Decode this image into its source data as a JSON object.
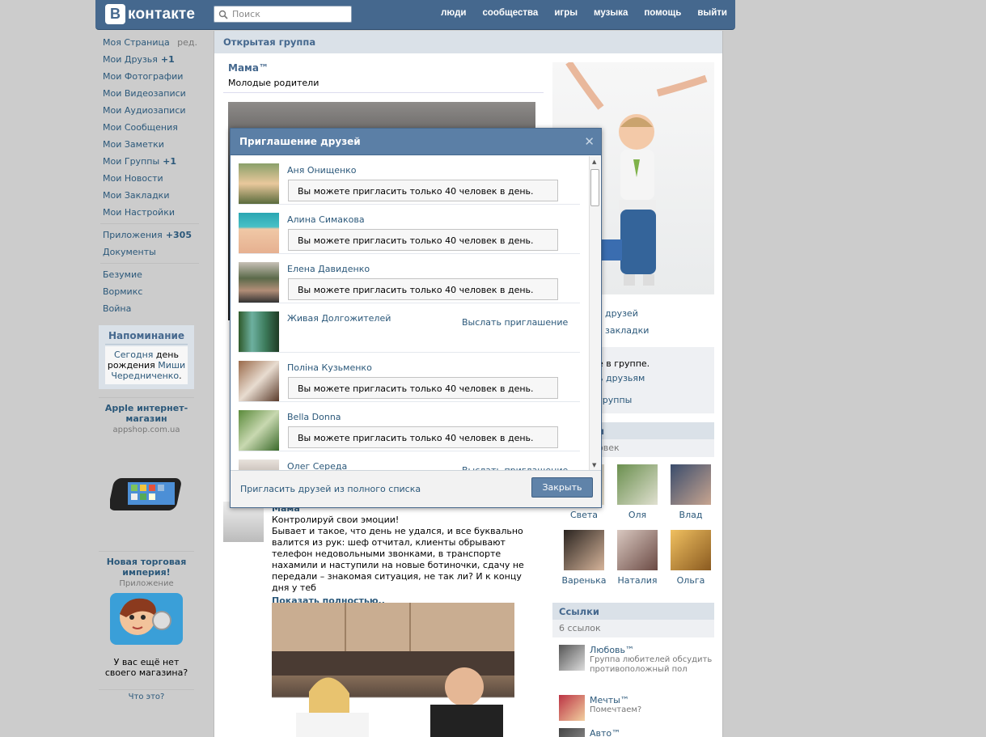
{
  "header": {
    "logo_letter": "В",
    "logo_text": "контакте",
    "search_placeholder": "Поиск",
    "nav": [
      "люди",
      "сообщества",
      "игры",
      "музыка",
      "помощь",
      "выйти"
    ]
  },
  "left_menu": {
    "items": [
      {
        "label": "Моя Страница",
        "extra": "ред."
      },
      {
        "label": "Мои Друзья",
        "count": "+1"
      },
      {
        "label": "Мои Фотографии"
      },
      {
        "label": "Мои Видеозаписи"
      },
      {
        "label": "Мои Аудиозаписи"
      },
      {
        "label": "Мои Сообщения"
      },
      {
        "label": "Мои Заметки"
      },
      {
        "label": "Мои Группы",
        "count": "+1"
      },
      {
        "label": "Мои Новости"
      },
      {
        "label": "Мои Закладки"
      },
      {
        "label": "Мои Настройки"
      }
    ],
    "apps": [
      {
        "label": "Приложения",
        "count": "+305"
      },
      {
        "label": "Документы"
      }
    ],
    "shortcuts": [
      "Безумие",
      "Вормикс",
      "Война"
    ]
  },
  "reminder": {
    "title": "Напоминание",
    "today": "Сегодня",
    "text1": "день",
    "text2": "рождения",
    "name_first": "Миши",
    "name_last": "Чередниченко",
    "dot": "."
  },
  "ads": [
    {
      "title": "Apple интернет-магазин",
      "sub": "appshop.com.ua"
    },
    {
      "title": "Новая торговая империя!",
      "sub": "Приложение",
      "caption": "У вас ещё нет своего магазина?"
    }
  ],
  "ads_footer": "Что это?",
  "content": {
    "header": "Открытая группа",
    "group_name": "Мама™",
    "group_status": "Молодые родители",
    "side_partial": [
      "ь друзей",
      "в закладки",
      "е в группе.",
      "ь друзьям",
      "группы"
    ],
    "members_head_partial": "и",
    "members_sub_partial": "овек"
  },
  "friends": [
    {
      "name": "Света"
    },
    {
      "name": "Оля"
    },
    {
      "name": "Влад"
    },
    {
      "name": "Варенька"
    },
    {
      "name": "Наталия"
    },
    {
      "name": "Ольга"
    }
  ],
  "links": {
    "title": "Ссылки",
    "count": "6 ссылок",
    "items": [
      {
        "title": "Любовь™",
        "desc": "Группа любителей обсудить противоположный пол"
      },
      {
        "title": "Мечты™",
        "desc": "Помечтаем?"
      },
      {
        "title": "Авто™",
        "desc": ""
      }
    ]
  },
  "post": {
    "author": "Мама™",
    "text": "Контролируй свои эмоции!\nБывает и такое, что день не удался, и все буквально валится из рук: шеф отчитал, клиенты обрывают телефон недовольными звонками, в транспорте нахамили и наступили на новые ботиночки, сдачу не передали – знакомая ситуация, не так ли? И к концу дня у теб",
    "more": "Показать полностью.."
  },
  "dialog": {
    "title": "Приглашение друзей",
    "close": "✕",
    "limit_message": "Вы можете пригласить только 40 человек в день.",
    "invite_label": "Выслать приглашение",
    "rows": [
      {
        "name": "Аня Онищенко",
        "state": "limit"
      },
      {
        "name": "Алина Симакова",
        "state": "limit"
      },
      {
        "name": "Елена Давиденко",
        "state": "limit"
      },
      {
        "name": "Живая Долгожителей",
        "state": "invite"
      },
      {
        "name": "Поліна Кузьменко",
        "state": "limit"
      },
      {
        "name": "Bella Donna",
        "state": "limit"
      },
      {
        "name": "Олег Середа",
        "state": "invite"
      }
    ],
    "full_list": "Пригласить друзей из полного списка",
    "close_button": "Закрыть"
  },
  "colors": {
    "header": "#45688e",
    "link": "#2b587a",
    "dialog_head": "#5b7fa6",
    "button": "#6083a9"
  }
}
